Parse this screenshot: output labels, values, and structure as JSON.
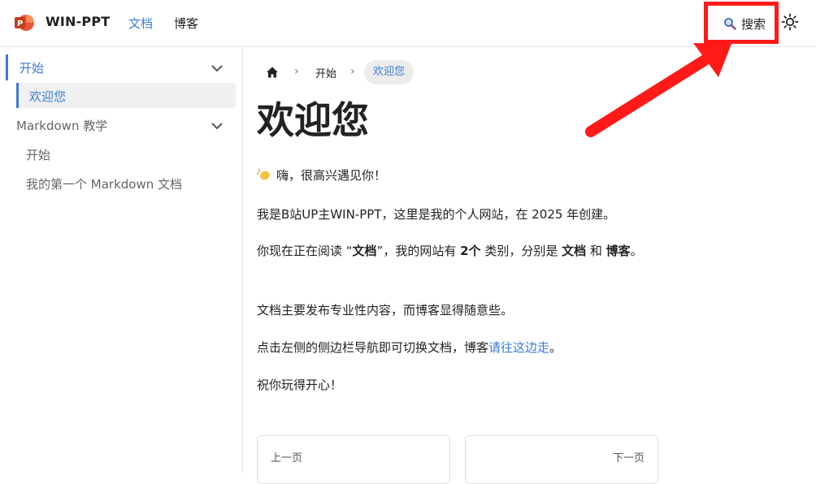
{
  "navbar": {
    "brand": "WIN-PPT",
    "links": [
      "文档",
      "博客"
    ],
    "search_label": "搜索"
  },
  "sidebar": {
    "items": [
      {
        "label": "开始"
      },
      {
        "label": "欢迎您"
      },
      {
        "label": "Markdown 教学"
      },
      {
        "label": "开始"
      },
      {
        "label": "我的第一个 Markdown 文档"
      }
    ]
  },
  "breadcrumb": {
    "items": [
      "开始",
      "欢迎您"
    ]
  },
  "main": {
    "title": "欢迎您",
    "greeting": "嗨，很高兴遇见你！",
    "intro": "我是B站UP主WIN-PPT，这里是我的个人网站，在 2025 年创建。",
    "reading_1": "你现在正在阅读 “",
    "reading_docs": "文档",
    "reading_2": "”，我的网站有 ",
    "reading_count": "2个",
    "reading_3": " 类别，分别是 ",
    "reading_cat1": "文档",
    "reading_and": " 和 ",
    "reading_cat2": "博客",
    "reading_end": "。",
    "publish": "文档主要发布专业性内容，而博客显得随意些。",
    "nav_hint": "点击左侧的侧边栏导航即可切换文档，博客",
    "nav_link": "请往这边走",
    "nav_end": "。",
    "closing": "祝你玩得开心！"
  },
  "pager": {
    "prev": "上一页",
    "next": "下一页"
  },
  "icons": {
    "logo": "powerpoint-logo-icon",
    "search": "search-icon",
    "theme": "sun-icon",
    "home": "home-icon",
    "wave": "waving-hand-icon",
    "annotation": "red-arrow-annotation"
  },
  "colors": {
    "accent": "#3a7bd5",
    "annotation": "#ff1a1a"
  }
}
